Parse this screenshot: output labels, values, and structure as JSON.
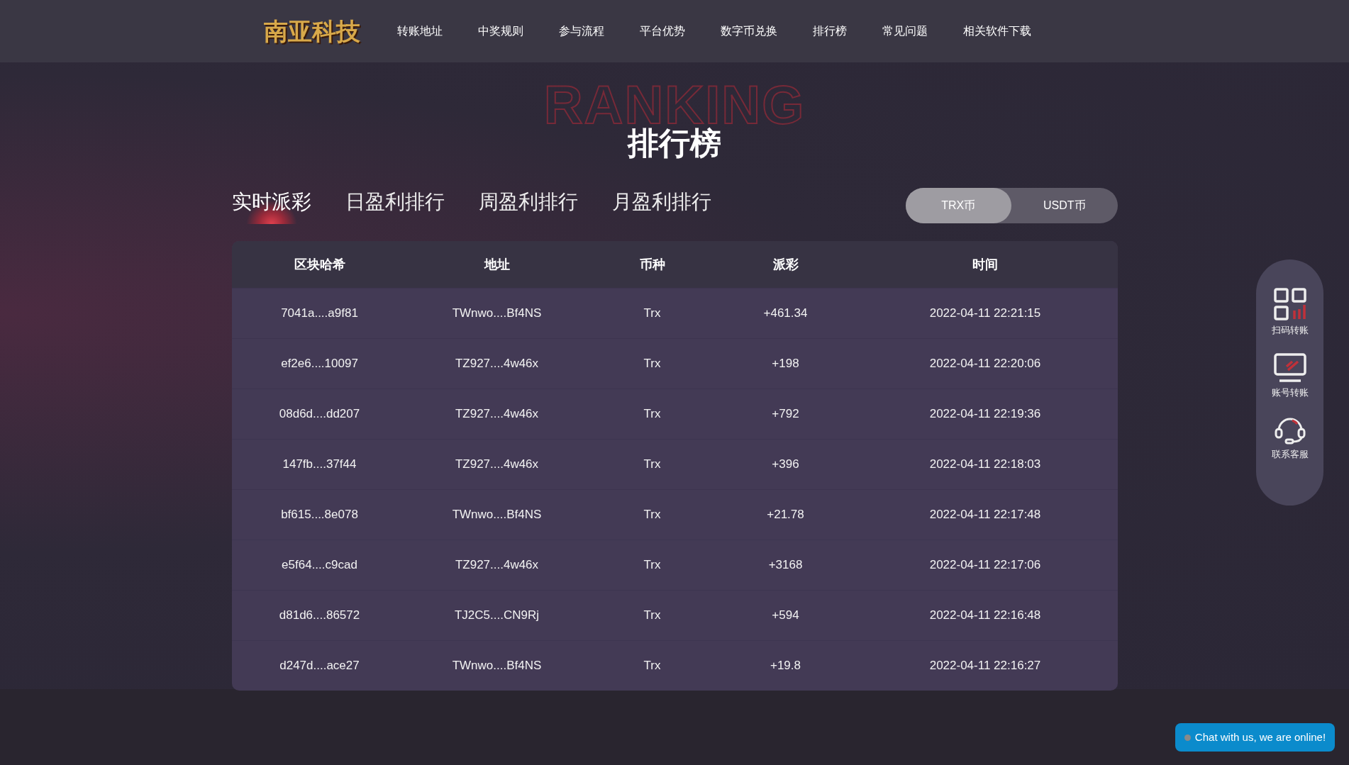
{
  "header": {
    "logo": "南亚科技",
    "nav": [
      {
        "label": "转账地址"
      },
      {
        "label": "中奖规则"
      },
      {
        "label": "参与流程"
      },
      {
        "label": "平台优势"
      },
      {
        "label": "数字币兑换"
      },
      {
        "label": "排行榜"
      },
      {
        "label": "常见问题"
      },
      {
        "label": "相关软件下载"
      }
    ]
  },
  "title": {
    "background_word": "RANKING",
    "heading": "排行榜"
  },
  "tabs": [
    {
      "label": "实时派彩",
      "selected": true
    },
    {
      "label": "日盈利排行",
      "selected": false
    },
    {
      "label": "周盈利排行",
      "selected": false
    },
    {
      "label": "月盈利排行",
      "selected": false
    }
  ],
  "currency_toggle": [
    {
      "label": "TRX币",
      "selected": true
    },
    {
      "label": "USDT币",
      "selected": false
    }
  ],
  "table": {
    "columns": [
      "区块哈希",
      "地址",
      "币种",
      "派彩",
      "时间"
    ],
    "rows": [
      [
        "7041a....a9f81",
        "TWnwo....Bf4NS",
        "Trx",
        "+461.34",
        "2022-04-11 22:21:15"
      ],
      [
        "ef2e6....10097",
        "TZ927....4w46x",
        "Trx",
        "+198",
        "2022-04-11 22:20:06"
      ],
      [
        "08d6d....dd207",
        "TZ927....4w46x",
        "Trx",
        "+792",
        "2022-04-11 22:19:36"
      ],
      [
        "147fb....37f44",
        "TZ927....4w46x",
        "Trx",
        "+396",
        "2022-04-11 22:18:03"
      ],
      [
        "bf615....8e078",
        "TWnwo....Bf4NS",
        "Trx",
        "+21.78",
        "2022-04-11 22:17:48"
      ],
      [
        "e5f64....c9cad",
        "TZ927....4w46x",
        "Trx",
        "+3168",
        "2022-04-11 22:17:06"
      ],
      [
        "d81d6....86572",
        "TJ2C5....CN9Rj",
        "Trx",
        "+594",
        "2022-04-11 22:16:48"
      ],
      [
        "d247d....ace27",
        "TWnwo....Bf4NS",
        "Trx",
        "+19.8",
        "2022-04-11 22:16:27"
      ]
    ]
  },
  "side_menu": [
    {
      "kind": "qr",
      "label": "扫码转账"
    },
    {
      "kind": "monitor",
      "label": "账号转账"
    },
    {
      "kind": "headset",
      "label": "联系客服"
    }
  ],
  "chat_button": {
    "label": "Chat with us, we are online!"
  }
}
